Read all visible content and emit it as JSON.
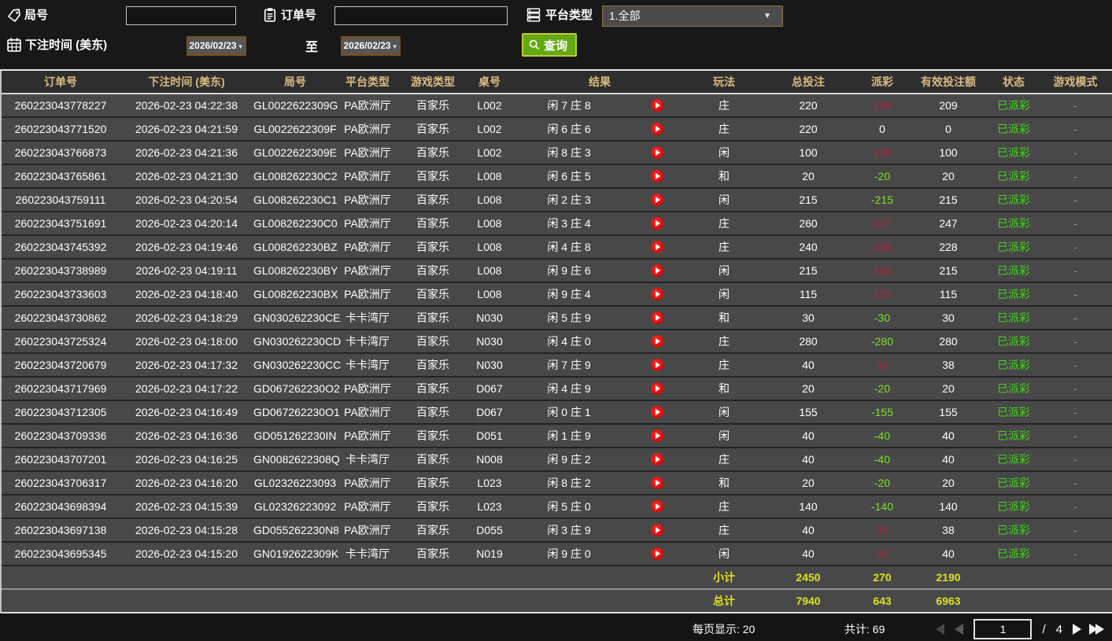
{
  "filters": {
    "round_label": "局号",
    "round_value": "",
    "order_label": "订单号",
    "order_value": "",
    "platform_label": "平台类型",
    "platform_value": "1.全部",
    "time_label": "下注时间 (美东)",
    "date_from": "2026/02/23",
    "to_label": "至",
    "date_to": "2026/02/23",
    "search_label": "查询"
  },
  "table": {
    "headers": [
      "订单号",
      "下注时间 (美东)",
      "局号",
      "平台类型",
      "游戏类型",
      "桌号",
      "结果",
      "玩法",
      "总投注",
      "派彩",
      "有效投注额",
      "状态",
      "游戏模式"
    ],
    "rows": [
      {
        "order": "260223043778227",
        "time": "2026-02-23 04:22:38",
        "round": "GL0022622309G",
        "platform": "PA欧洲厅",
        "game": "百家乐",
        "table": "L002",
        "result": "闲 7 庄 8",
        "play": "庄",
        "bet": "220",
        "payout": "209",
        "valid": "209",
        "status": "已派彩",
        "mode": "-"
      },
      {
        "order": "260223043771520",
        "time": "2026-02-23 04:21:59",
        "round": "GL0022622309F",
        "platform": "PA欧洲厅",
        "game": "百家乐",
        "table": "L002",
        "result": "闲 6 庄 6",
        "play": "庄",
        "bet": "220",
        "payout": "0",
        "valid": "0",
        "status": "已派彩",
        "mode": "-"
      },
      {
        "order": "260223043766873",
        "time": "2026-02-23 04:21:36",
        "round": "GL0022622309E",
        "platform": "PA欧洲厅",
        "game": "百家乐",
        "table": "L002",
        "result": "闲 8 庄 3",
        "play": "闲",
        "bet": "100",
        "payout": "100",
        "valid": "100",
        "status": "已派彩",
        "mode": "-"
      },
      {
        "order": "260223043765861",
        "time": "2026-02-23 04:21:30",
        "round": "GL008262230C2",
        "platform": "PA欧洲厅",
        "game": "百家乐",
        "table": "L008",
        "result": "闲 6 庄 5",
        "play": "和",
        "bet": "20",
        "payout": "-20",
        "valid": "20",
        "status": "已派彩",
        "mode": "-"
      },
      {
        "order": "260223043759111",
        "time": "2026-02-23 04:20:54",
        "round": "GL008262230C1",
        "platform": "PA欧洲厅",
        "game": "百家乐",
        "table": "L008",
        "result": "闲 2 庄 3",
        "play": "闲",
        "bet": "215",
        "payout": "-215",
        "valid": "215",
        "status": "已派彩",
        "mode": "-"
      },
      {
        "order": "260223043751691",
        "time": "2026-02-23 04:20:14",
        "round": "GL008262230C0",
        "platform": "PA欧洲厅",
        "game": "百家乐",
        "table": "L008",
        "result": "闲 3 庄 4",
        "play": "庄",
        "bet": "260",
        "payout": "247",
        "valid": "247",
        "status": "已派彩",
        "mode": "-"
      },
      {
        "order": "260223043745392",
        "time": "2026-02-23 04:19:46",
        "round": "GL008262230BZ",
        "platform": "PA欧洲厅",
        "game": "百家乐",
        "table": "L008",
        "result": "闲 4 庄 8",
        "play": "庄",
        "bet": "240",
        "payout": "228",
        "valid": "228",
        "status": "已派彩",
        "mode": "-"
      },
      {
        "order": "260223043738989",
        "time": "2026-02-23 04:19:11",
        "round": "GL008262230BY",
        "platform": "PA欧洲厅",
        "game": "百家乐",
        "table": "L008",
        "result": "闲 9 庄 6",
        "play": "闲",
        "bet": "215",
        "payout": "215",
        "valid": "215",
        "status": "已派彩",
        "mode": "-"
      },
      {
        "order": "260223043733603",
        "time": "2026-02-23 04:18:40",
        "round": "GL008262230BX",
        "platform": "PA欧洲厅",
        "game": "百家乐",
        "table": "L008",
        "result": "闲 9 庄 4",
        "play": "闲",
        "bet": "115",
        "payout": "115",
        "valid": "115",
        "status": "已派彩",
        "mode": "-"
      },
      {
        "order": "260223043730862",
        "time": "2026-02-23 04:18:29",
        "round": "GN030262230CE",
        "platform": "卡卡湾厅",
        "game": "百家乐",
        "table": "N030",
        "result": "闲 5 庄 9",
        "play": "和",
        "bet": "30",
        "payout": "-30",
        "valid": "30",
        "status": "已派彩",
        "mode": "-"
      },
      {
        "order": "260223043725324",
        "time": "2026-02-23 04:18:00",
        "round": "GN030262230CD",
        "platform": "卡卡湾厅",
        "game": "百家乐",
        "table": "N030",
        "result": "闲 4 庄 0",
        "play": "庄",
        "bet": "280",
        "payout": "-280",
        "valid": "280",
        "status": "已派彩",
        "mode": "-"
      },
      {
        "order": "260223043720679",
        "time": "2026-02-23 04:17:32",
        "round": "GN030262230CC",
        "platform": "卡卡湾厅",
        "game": "百家乐",
        "table": "N030",
        "result": "闲 7 庄 9",
        "play": "庄",
        "bet": "40",
        "payout": "38",
        "valid": "38",
        "status": "已派彩",
        "mode": "-"
      },
      {
        "order": "260223043717969",
        "time": "2026-02-23 04:17:22",
        "round": "GD067262230O2",
        "platform": "PA欧洲厅",
        "game": "百家乐",
        "table": "D067",
        "result": "闲 4 庄 9",
        "play": "和",
        "bet": "20",
        "payout": "-20",
        "valid": "20",
        "status": "已派彩",
        "mode": "-"
      },
      {
        "order": "260223043712305",
        "time": "2026-02-23 04:16:49",
        "round": "GD067262230O1",
        "platform": "PA欧洲厅",
        "game": "百家乐",
        "table": "D067",
        "result": "闲 0 庄 1",
        "play": "闲",
        "bet": "155",
        "payout": "-155",
        "valid": "155",
        "status": "已派彩",
        "mode": "-"
      },
      {
        "order": "260223043709336",
        "time": "2026-02-23 04:16:36",
        "round": "GD051262230IN",
        "platform": "PA欧洲厅",
        "game": "百家乐",
        "table": "D051",
        "result": "闲 1 庄 9",
        "play": "闲",
        "bet": "40",
        "payout": "-40",
        "valid": "40",
        "status": "已派彩",
        "mode": "-"
      },
      {
        "order": "260223043707201",
        "time": "2026-02-23 04:16:25",
        "round": "GN0082622308Q",
        "platform": "卡卡湾厅",
        "game": "百家乐",
        "table": "N008",
        "result": "闲 9 庄 2",
        "play": "庄",
        "bet": "40",
        "payout": "-40",
        "valid": "40",
        "status": "已派彩",
        "mode": "-"
      },
      {
        "order": "260223043706317",
        "time": "2026-02-23 04:16:20",
        "round": "GL02326223093",
        "platform": "PA欧洲厅",
        "game": "百家乐",
        "table": "L023",
        "result": "闲 8 庄 2",
        "play": "和",
        "bet": "20",
        "payout": "-20",
        "valid": "20",
        "status": "已派彩",
        "mode": "-"
      },
      {
        "order": "260223043698394",
        "time": "2026-02-23 04:15:39",
        "round": "GL02326223092",
        "platform": "PA欧洲厅",
        "game": "百家乐",
        "table": "L023",
        "result": "闲 5 庄 0",
        "play": "庄",
        "bet": "140",
        "payout": "-140",
        "valid": "140",
        "status": "已派彩",
        "mode": "-"
      },
      {
        "order": "260223043697138",
        "time": "2026-02-23 04:15:28",
        "round": "GD055262230N8",
        "platform": "PA欧洲厅",
        "game": "百家乐",
        "table": "D055",
        "result": "闲 3 庄 9",
        "play": "庄",
        "bet": "40",
        "payout": "38",
        "valid": "38",
        "status": "已派彩",
        "mode": "-"
      },
      {
        "order": "260223043695345",
        "time": "2026-02-23 04:15:20",
        "round": "GN0192622309K",
        "platform": "卡卡湾厅",
        "game": "百家乐",
        "table": "N019",
        "result": "闲 9 庄 0",
        "play": "闲",
        "bet": "40",
        "payout": "40",
        "valid": "40",
        "status": "已派彩",
        "mode": "-"
      }
    ],
    "subtotal": {
      "label": "小计",
      "bet": "2450",
      "payout": "270",
      "valid": "2190"
    },
    "total": {
      "label": "总计",
      "bet": "7940",
      "payout": "643",
      "valid": "6963"
    }
  },
  "footer": {
    "per_page_text": "每页显示: 20",
    "count_text": "共计: 69",
    "page": "1",
    "page_sep": "/",
    "total_pages": "4"
  },
  "colors": {
    "header_text": "#d8bc84",
    "payout_win": "#a82838",
    "payout_loss": "#7ce028",
    "status_green": "#46d51f",
    "total_yellow": "#dfe01e",
    "search_green": "#64a913",
    "date_border": "#7a4d1d"
  }
}
